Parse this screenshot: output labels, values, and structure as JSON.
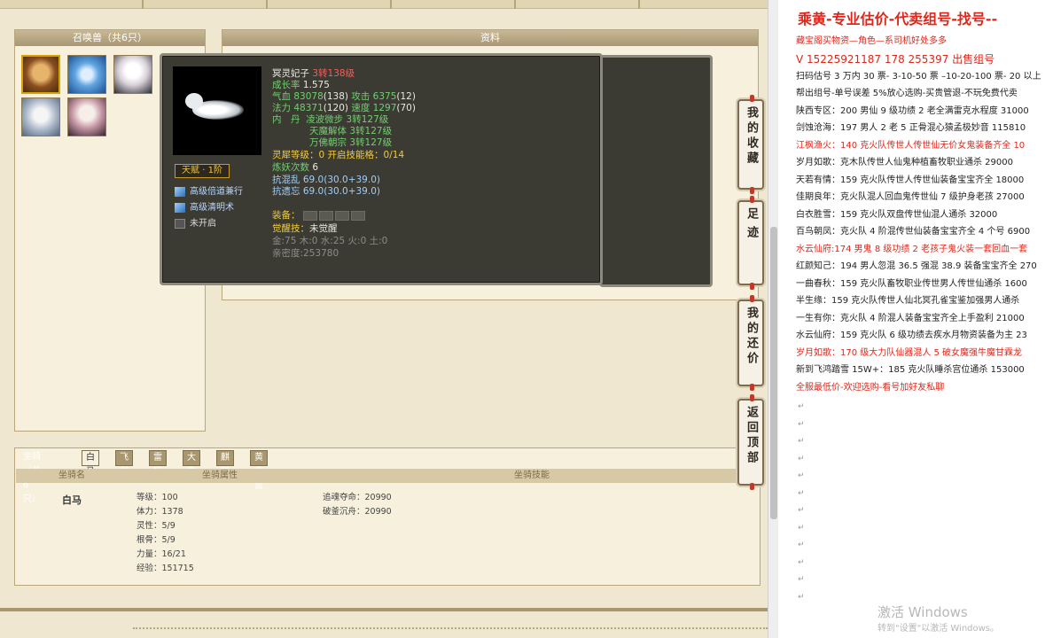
{
  "pets_panel": {
    "title": "召唤兽（共6只）"
  },
  "detail_panel": {
    "title": "资料"
  },
  "tooltip": {
    "name": "冥灵妃子",
    "level": "3转138级",
    "growth_label": "成长率",
    "growth": "1.575",
    "hp_label": "气血",
    "hp": "83078",
    "hp_points": "(138)",
    "atk_label": "攻击",
    "atk": "6375",
    "atk_points": "(12)",
    "mp_label": "法力",
    "mp": "48371",
    "mp_points": "(120)",
    "spd_label": "速度",
    "spd": "1297",
    "spd_points": "(70)",
    "inner_label": "内　丹",
    "inner": [
      {
        "name": "凌波微步",
        "lv": "3转127级"
      },
      {
        "name": "天魔解体",
        "lv": "3转127级"
      },
      {
        "name": "万佛朝宗",
        "lv": "3转127级"
      }
    ],
    "spirit_label": "灵犀等级",
    "spirit": "：0 开启技能格",
    "spirit_cells": "：0/14",
    "refine_label": "炼妖次数",
    "refine": "6",
    "resist1_label": "抗混乱",
    "resist1": "69.0(30.0+39.0)",
    "resist2_label": "抗遗忘",
    "resist2": "69.0(30.0+39.0)",
    "equip_label": "装备：",
    "awake_label": "觉醒技：",
    "awake": "未觉醒",
    "elements": "金:75 木:0 水:25 火:0 土:0",
    "intimacy": "亲密度:253780",
    "talent": "天赋 · 1阶",
    "skills": [
      "高级倍道兼行",
      "高级清明术",
      "未开启"
    ]
  },
  "mount": {
    "title": "坐骑（共6只）",
    "tabs": [
      "白马",
      "飞剑",
      "雷狼",
      "大象",
      "麒麟",
      "黄金鼠"
    ],
    "headers": [
      "坐骑名",
      "坐骑属性",
      "坐骑技能"
    ],
    "name": "白马",
    "attrs": [
      "等级：100",
      "体力：1378",
      "灵性：5/9",
      "根骨：5/9",
      "力量：16/21",
      "经验：151715"
    ],
    "skills": [
      "追魂夺命：20990",
      "破釜沉舟：20990"
    ]
  },
  "side_buttons": [
    "我的收藏",
    "足迹",
    "我的还价",
    "返回顶部"
  ],
  "doc": {
    "title": "乘黄-专业估价-代卖组号-找号--",
    "lines": [
      {
        "t": "藏宝阁买物资—角色—系司机好处多多",
        "red": true
      },
      {
        "t": "V 15225921187  178 255397  出售组号",
        "red": true,
        "big": true
      },
      {
        "t": "扫码估号 3 万内 30 票- 3-10-50 票 –10-20-100 票- 20 以上",
        "red": false
      },
      {
        "t": "帮出组号-单号误差 5%放心选购-买贵管退-不玩免费代卖",
        "red": false
      },
      {
        "t": "陕西专区：200 男仙 9 级功绩 2 老全满雷克水程度 31000",
        "red": false
      },
      {
        "t": "剑蚀沧海：197 男人 2 老 5 正骨混心猿孟极妙音 115810",
        "red": false
      },
      {
        "t": "江枫渔火：140 克火队传世人传世仙无价女鬼装备齐全 10",
        "red": true
      },
      {
        "t": "岁月如歌：克木队传世人仙鬼种植畜牧职业通杀 29000",
        "red": false
      },
      {
        "t": "天若有情：159 克火队传世人传世仙装备宝宝齐全 18000",
        "red": false
      },
      {
        "t": "佳期良年：克火队混人回血鬼传世仙 7 级护身老孩 27000",
        "red": false
      },
      {
        "t": "白衣胜雪：159 克火队双盘传世仙混人通杀 32000",
        "red": false
      },
      {
        "t": "百鸟朝凤：克火队 4 阶混传世仙装备宝宝齐全 4 个号 6900",
        "red": false
      },
      {
        "t": "水云仙府:174 男鬼 8 级功绩 2 老孩子鬼火装一套回血一套",
        "red": true
      },
      {
        "t": "红颜知己：194 男人忽混 36.5 强混 38.9 装备宝宝齐全 270",
        "red": false
      },
      {
        "t": "一曲春秋：159 克火队畜牧职业传世男人传世仙通杀 1600",
        "red": false
      },
      {
        "t": "半生缘：159 克火队传世人仙北冥孔雀宝鉴加强男人通杀",
        "red": false
      },
      {
        "t": "一生有你：克火队 4 阶混人装备宝宝齐全上手盈利 21000",
        "red": false
      },
      {
        "t": "水云仙府：159 克火队 6 级功绩去疾水月物资装备为主 23",
        "red": false
      },
      {
        "t": "岁月如歌：170 级大力队仙器混人 5 破女魔强牛魔甘霖龙",
        "red": true
      },
      {
        "t": "新到飞鸿踏雪 15W+：185 克火队睡杀宫位通杀 153000",
        "red": false
      },
      {
        "t": "全服最低价-欢迎选购-看号加好友私聊",
        "red": true
      }
    ],
    "watermark": "激活 Windows",
    "watermark_sub": "转到\"设置\"以激活 Windows。"
  },
  "colors": {
    "accent_red": "#e0261a",
    "tooltip_bg": "#3b3a33",
    "stat_green": "#6fd26f",
    "level_red": "#ff5a5a"
  }
}
